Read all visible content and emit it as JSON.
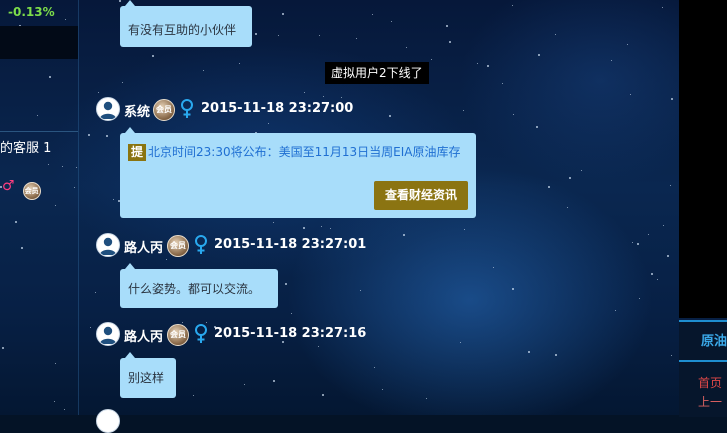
{
  "left_panel": {
    "ticker_change": "-0.13%",
    "customer_service_label": "的客服 1",
    "badge_label": "会员"
  },
  "right_panel": {
    "tab_label": "原油",
    "link_1": "首页",
    "link_2": "上一"
  },
  "chat": {
    "prev_message": "有没有互助的小伙伴",
    "system_notice": "虚拟用户2下线了",
    "messages": [
      {
        "username": "系统",
        "badge": "会员",
        "timestamp": "2015-11-18 23:27:00",
        "tag": "提",
        "text": "北京时间23:30将公布：美国至11月13日当周EIA原油库存",
        "button_label": "查看财经资讯"
      },
      {
        "username": "路人丙",
        "badge": "会员",
        "timestamp": "2015-11-18 23:27:01",
        "text": "什么姿势。都可以交流。"
      },
      {
        "username": "路人丙",
        "badge": "会员",
        "timestamp": "2015-11-18 23:27:16",
        "text": "别这样"
      }
    ]
  },
  "colors": {
    "bubble": "#a8ddfa",
    "button": "#8b7412",
    "accent": "#1e8ed0",
    "ticker_up": "#7dde4a"
  }
}
